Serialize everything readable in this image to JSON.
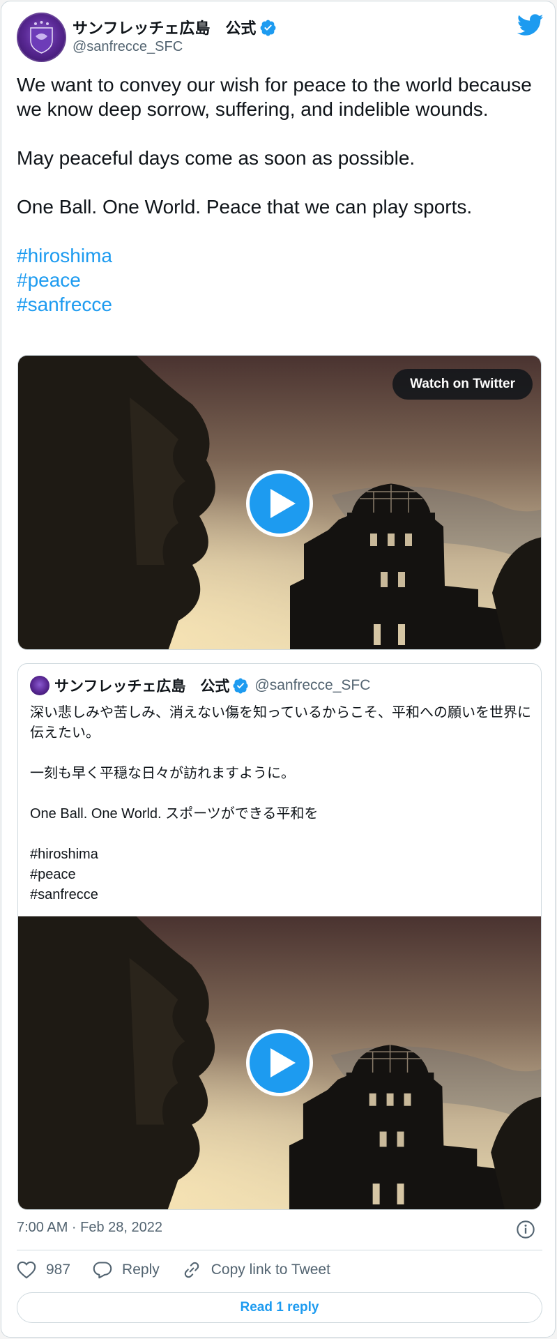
{
  "author": {
    "display_name": "サンフレッチェ広島　公式",
    "handle": "@sanfrecce_SFC",
    "verified": true
  },
  "tweet": {
    "paragraphs": [
      "We want to convey our wish for peace to the world because we know deep sorrow, suffering, and indelible wounds.",
      "May peaceful days come as soon as possible.",
      "One Ball. One World. Peace that we can play sports."
    ],
    "hashtags": [
      "#hiroshima",
      "#peace",
      "#sanfrecce"
    ]
  },
  "media": {
    "watch_label": "Watch on Twitter"
  },
  "quote": {
    "display_name": "サンフレッチェ広島　公式",
    "handle": "@sanfrecce_SFC",
    "paragraphs": [
      "深い悲しみや苦しみ、消えない傷を知っているからこそ、平和への願いを世界に伝えたい。",
      "一刻も早く平穏な日々が訪れますように。",
      "One Ball. One World. スポーツができる平和を"
    ],
    "hashtags": [
      "#hiroshima",
      "#peace",
      "#sanfrecce"
    ]
  },
  "footer": {
    "timestamp": "7:00 AM · Feb 28, 2022",
    "like_count": "987",
    "reply_label": "Reply",
    "copy_label": "Copy link to Tweet",
    "read_replies_label": "Read 1 reply"
  },
  "colors": {
    "accent": "#1d9bf0",
    "text": "#0f1419",
    "muted": "#536471",
    "border": "#cfd9de"
  },
  "icons": [
    "twitter-bird-icon",
    "verified-badge-icon",
    "play-icon",
    "heart-icon",
    "reply-icon",
    "link-icon",
    "info-icon"
  ]
}
